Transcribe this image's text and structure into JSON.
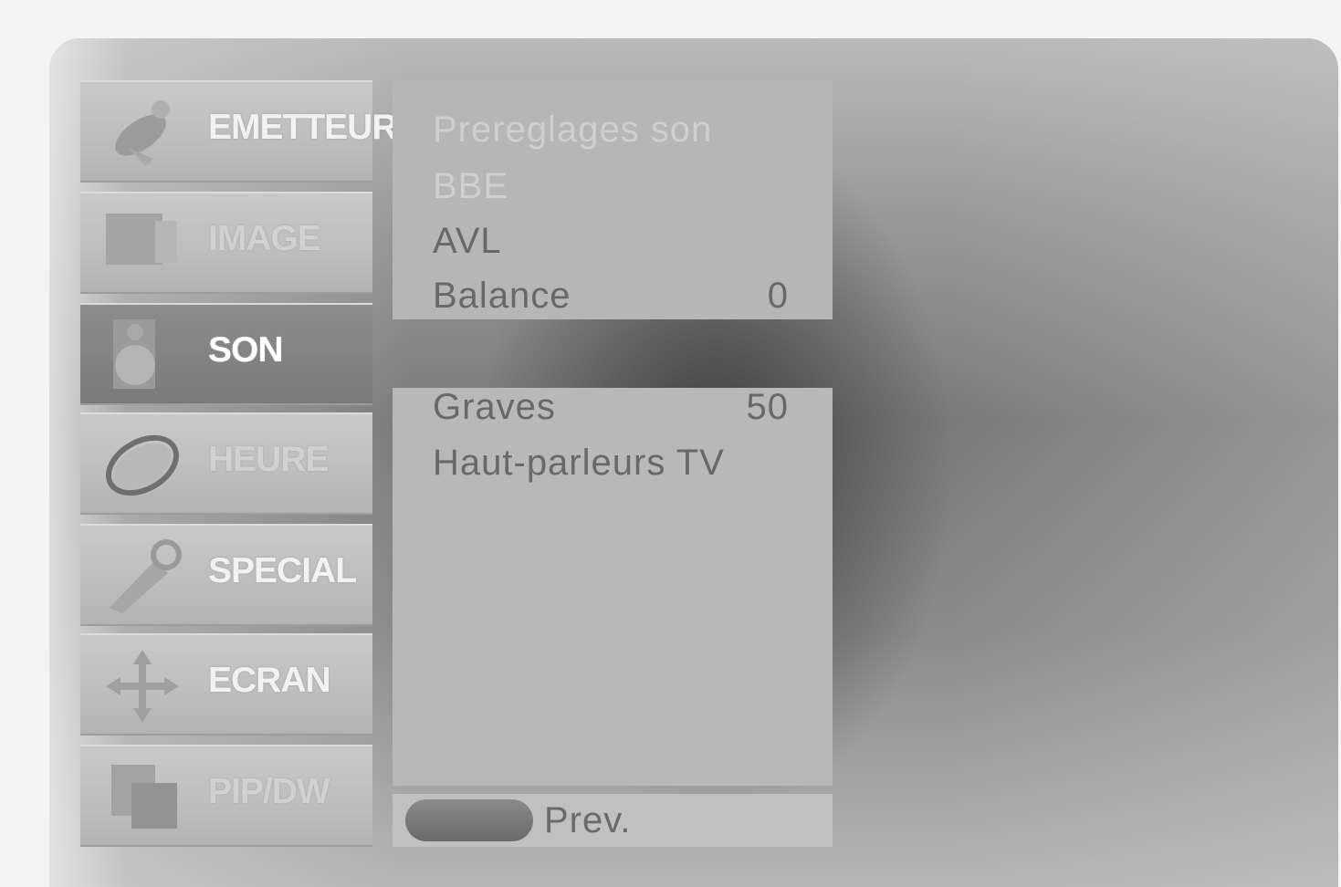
{
  "menu": {
    "items": [
      {
        "label": "EMETTEUR",
        "icon": "satellite-dish-icon"
      },
      {
        "label": "IMAGE",
        "icon": "picture-icon"
      },
      {
        "label": "SON",
        "icon": "speaker-icon",
        "selected": true
      },
      {
        "label": "HEURE",
        "icon": "clock-icon"
      },
      {
        "label": "SPECIAL",
        "icon": "key-icon"
      },
      {
        "label": "ECRAN",
        "icon": "arrows-icon"
      },
      {
        "label": "PIP/DW",
        "icon": "pip-icon"
      }
    ]
  },
  "submenu": {
    "top_items": [
      {
        "label": "Prereglages son",
        "value": ""
      },
      {
        "label": "BBE",
        "value": ""
      },
      {
        "label": "AVL",
        "value": ""
      },
      {
        "label": "Balance",
        "value": "0"
      }
    ],
    "bottom_items": [
      {
        "label": "Graves",
        "value": "50"
      },
      {
        "label": "Haut-parleurs TV",
        "value": ""
      }
    ]
  },
  "footer": {
    "prev_label": "Prev."
  },
  "colors": {
    "menu_bg": "#c0c0c0",
    "menu_selected_bg": "#808080",
    "panel_bg": "#b8b8b8",
    "text": "#686868"
  }
}
